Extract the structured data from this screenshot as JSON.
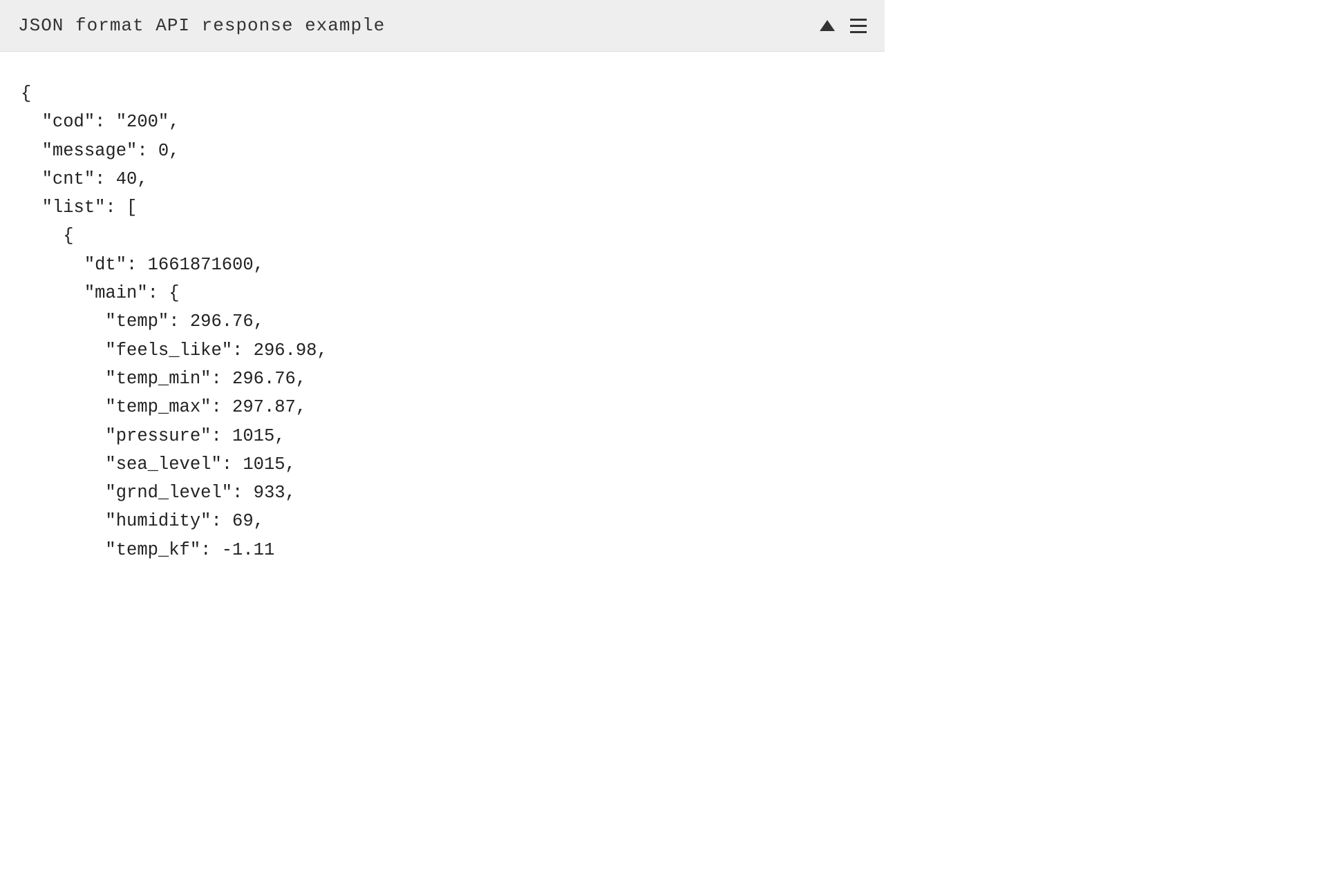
{
  "header": {
    "title": "JSON format API response example"
  },
  "code": {
    "lines": [
      "{",
      "  \"cod\": \"200\",",
      "  \"message\": 0,",
      "  \"cnt\": 40,",
      "  \"list\": [",
      "    {",
      "      \"dt\": 1661871600,",
      "      \"main\": {",
      "        \"temp\": 296.76,",
      "        \"feels_like\": 296.98,",
      "        \"temp_min\": 296.76,",
      "        \"temp_max\": 297.87,",
      "        \"pressure\": 1015,",
      "        \"sea_level\": 1015,",
      "        \"grnd_level\": 933,",
      "        \"humidity\": 69,",
      "        \"temp_kf\": -1.11"
    ]
  }
}
